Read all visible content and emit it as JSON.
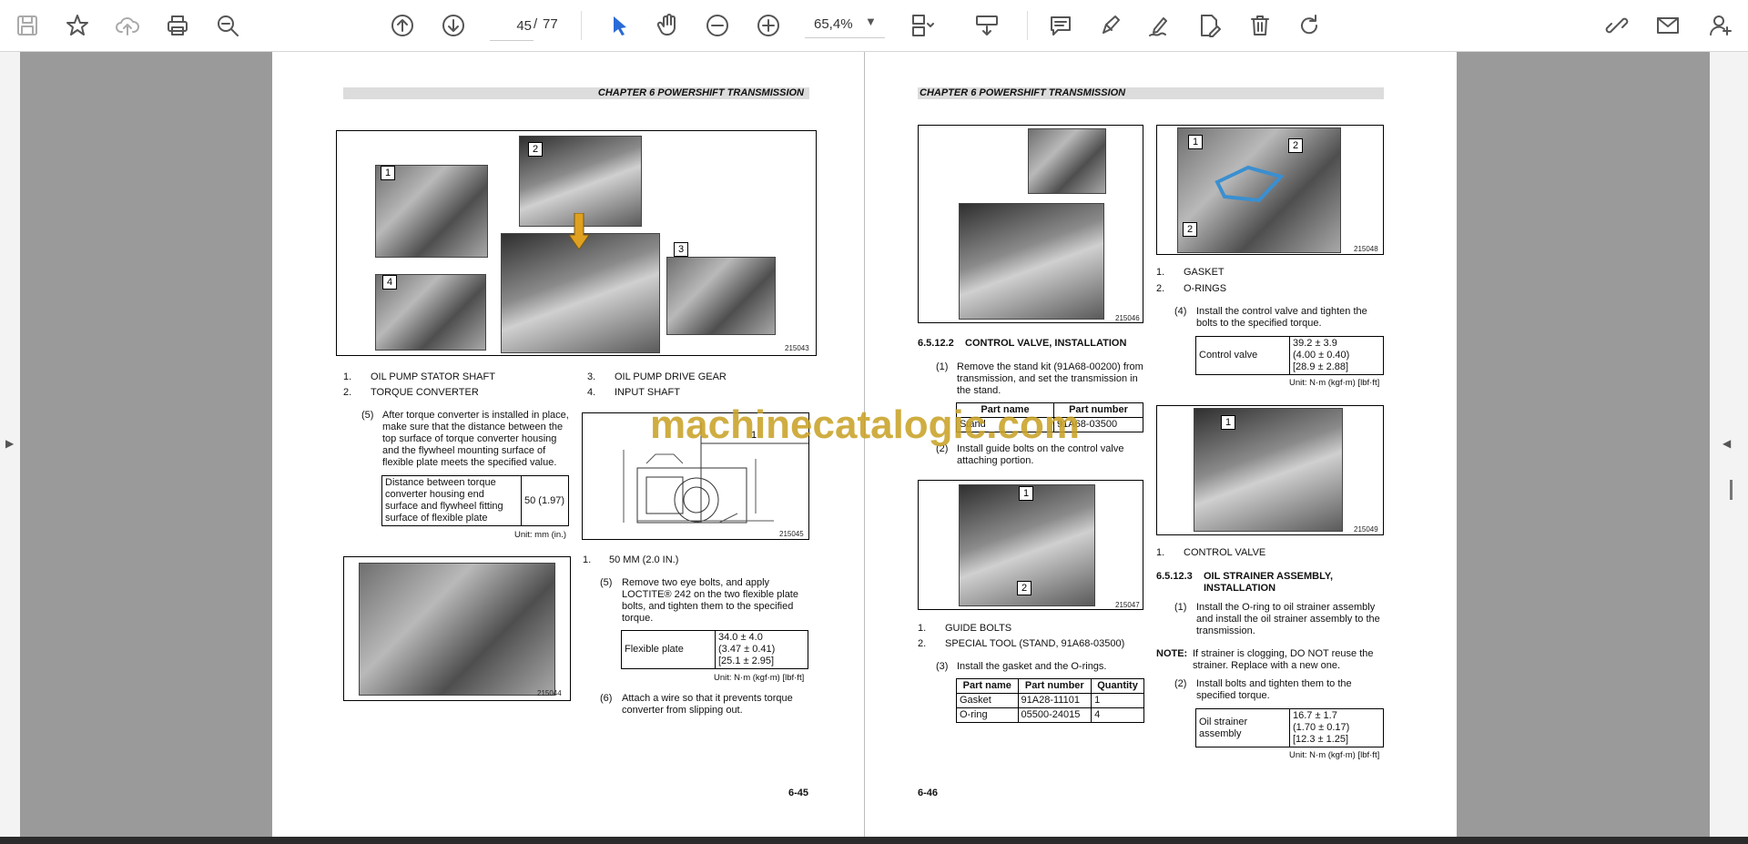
{
  "toolbar": {
    "page_current": "45",
    "page_separator": "/",
    "page_total": "77",
    "zoom": "65,4%",
    "icons": [
      "save-icon",
      "bookmark-star-icon",
      "cloud-upload-icon",
      "print-icon",
      "zoom-search-icon",
      "page-up-icon",
      "page-down-icon",
      "select-cursor-icon",
      "hand-icon",
      "zoom-out-icon",
      "zoom-in-icon",
      "page-layout-icon",
      "scroll-mode-icon",
      "comment-icon",
      "highlight-pen-icon",
      "sign-icon",
      "edit-pdf-icon",
      "delete-icon",
      "rotate-icon",
      "share-link-icon",
      "email-icon",
      "add-user-icon"
    ],
    "accent": "#2a6ad6"
  },
  "watermark": "machinecatalogic.com",
  "left_page": {
    "header": "CHAPTER 6 POWERSHIFT TRANSMISSION",
    "fig1": {
      "callouts": [
        "1",
        "2",
        "3",
        "4"
      ],
      "figno": "215043"
    },
    "legend": [
      {
        "n": "1.",
        "text": "OIL PUMP STATOR SHAFT"
      },
      {
        "n": "2.",
        "text": "TORQUE CONVERTER"
      },
      {
        "n": "3.",
        "text": "OIL PUMP DRIVE GEAR"
      },
      {
        "n": "4.",
        "text": "INPUT SHAFT"
      }
    ],
    "step5a": {
      "num": "(5)",
      "text": "After torque converter is installed in place, make sure that the distance between the top surface of torque converter housing and the flywheel mounting surface of flexible plate meets the specified value."
    },
    "dist_table": {
      "label": "Distance between torque converter housing end surface and flywheel fitting surface of flexible plate",
      "value": "50 (1.97)",
      "units": "Unit: mm (in.)"
    },
    "fig_drawing": {
      "callout": "1",
      "figno": "215045"
    },
    "fig_photo": {
      "figno": "215044"
    },
    "note_50mm": {
      "n": "1.",
      "text": "50 MM (2.0 IN.)"
    },
    "step5b": {
      "num": "(5)",
      "text": "Remove two eye bolts, and apply LOCTITE® 242 on the two flexible plate bolts, and tighten them to the specified torque."
    },
    "flex_table": {
      "label": "Flexible plate",
      "v1": "34.0 ± 4.0",
      "v2": "(3.47 ± 0.41)",
      "v3": "[25.1 ± 2.95]",
      "units": "Unit: N·m (kgf·m) [lbf·ft]"
    },
    "step6": {
      "num": "(6)",
      "text": "Attach a wire so that it prevents torque converter from slipping out."
    },
    "page_number": "6-45"
  },
  "right_page": {
    "header": "CHAPTER 6 POWERSHIFT TRANSMISSION",
    "fig_a": {
      "figno": "215046"
    },
    "section1": {
      "num": "6.5.12.2",
      "title": "CONTROL VALVE, INSTALLATION"
    },
    "step1": {
      "num": "(1)",
      "text": "Remove the stand kit (91A68-00200) from transmission, and set the transmission in the stand."
    },
    "part_table1": {
      "h1": "Part name",
      "h2": "Part number",
      "c1": "Stand",
      "c2": "91A68-03500"
    },
    "step2": {
      "num": "(2)",
      "text": "Install guide bolts on the control valve attaching portion."
    },
    "fig_b": {
      "callouts": [
        "1",
        "2"
      ],
      "figno": "215047"
    },
    "legend_b": [
      {
        "n": "1.",
        "text": "GUIDE BOLTS"
      },
      {
        "n": "2.",
        "text": "SPECIAL TOOL (STAND, 91A68-03500)"
      }
    ],
    "step3": {
      "num": "(3)",
      "text": "Install the gasket and the O-rings."
    },
    "part_table2": {
      "headers": [
        "Part name",
        "Part number",
        "Quantity"
      ],
      "rows": [
        [
          "Gasket",
          "91A28-11101",
          "1"
        ],
        [
          "O-ring",
          "05500-24015",
          "4"
        ]
      ]
    },
    "fig_c": {
      "callouts": [
        "1",
        "2",
        "2"
      ],
      "figno": "215048"
    },
    "legend_c": [
      {
        "n": "1.",
        "text": "GASKET"
      },
      {
        "n": "2.",
        "text": "O-RINGS"
      }
    ],
    "step4": {
      "num": "(4)",
      "text": "Install the control valve and tighten the bolts to the specified torque."
    },
    "cv_table": {
      "label": "Control valve",
      "v1": "39.2 ± 3.9",
      "v2": "(4.00 ± 0.40)",
      "v3": "[28.9 ± 2.88]",
      "units": "Unit: N·m (kgf·m) [lbf·ft]"
    },
    "fig_d": {
      "callouts": [
        "1"
      ],
      "figno": "215049"
    },
    "legend_d": {
      "n": "1.",
      "text": "CONTROL VALVE"
    },
    "section2": {
      "num": "6.5.12.3",
      "title": "OIL STRAINER ASSEMBLY, INSTALLATION"
    },
    "step1b": {
      "num": "(1)",
      "text": "Install the O-ring to oil strainer assembly and install the oil strainer assembly to the transmission."
    },
    "note": {
      "label": "NOTE:",
      "text": "If strainer is clogging, DO NOT reuse the strainer. Replace with a new one."
    },
    "step2b": {
      "num": "(2)",
      "text": "Install bolts and tighten them to the specified torque."
    },
    "os_table": {
      "label": "Oil strainer assembly",
      "v1": "16.7 ± 1.7",
      "v2": "(1.70 ± 0.17)",
      "v3": "[12.3 ± 1.25]",
      "units": "Unit: N·m (kgf·m) [lbf·ft]"
    },
    "page_number": "6-46"
  }
}
